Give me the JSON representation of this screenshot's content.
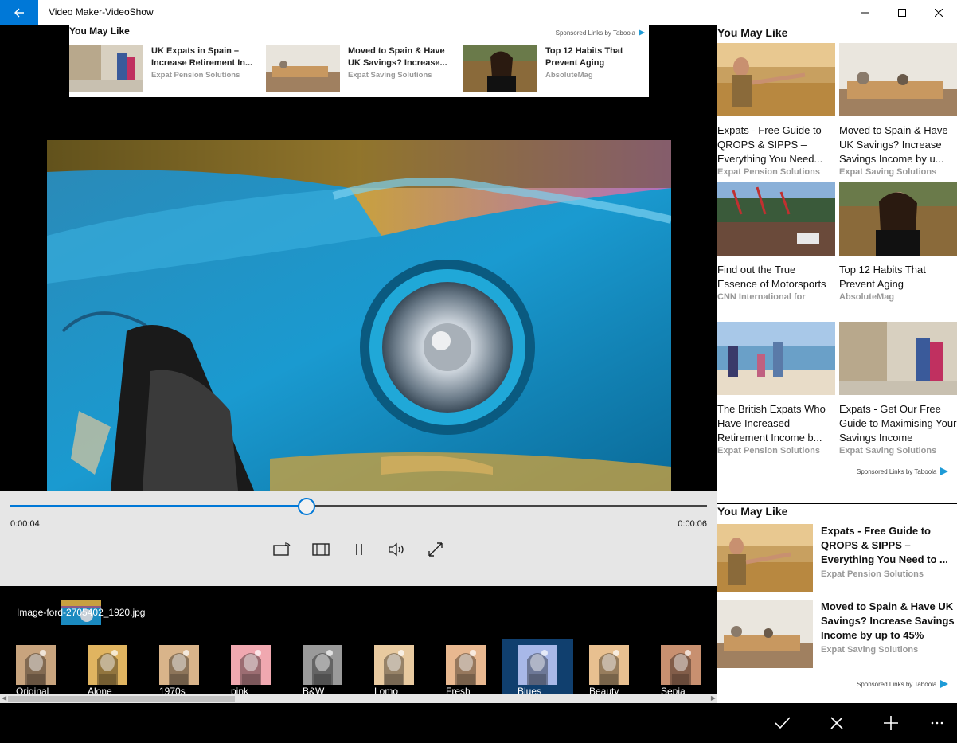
{
  "window": {
    "title": "Video Maker-VideoShow"
  },
  "top_ad": {
    "header": "You May Like",
    "sponsor": "Sponsored Links by Taboola",
    "items": [
      {
        "title": "UK Expats in Spain – Increase Retirement In...",
        "source": "Expat Pension Solutions"
      },
      {
        "title": "Moved to Spain & Have UK Savings? Increase...",
        "source": "Expat Saving Solutions"
      },
      {
        "title": "Top 12 Habits That Prevent Aging",
        "source": "AbsoluteMag"
      }
    ]
  },
  "player": {
    "current_time": "0:00:04",
    "total_time": "0:00:06",
    "progress": 0.425
  },
  "clip": {
    "filename": "Image-ford-2705402_1920.jpg"
  },
  "filters": [
    {
      "label": "Original",
      "tint": "#c8a47e"
    },
    {
      "label": "Alone",
      "tint": "#e0b460"
    },
    {
      "label": "1970s",
      "tint": "#d9b48a"
    },
    {
      "label": "pink",
      "tint": "#f0a8b0"
    },
    {
      "label": "B&W",
      "tint": "#9a9a9a"
    },
    {
      "label": "Lomo",
      "tint": "#e8caa0"
    },
    {
      "label": "Fresh",
      "tint": "#e8b890"
    },
    {
      "label": "Blues",
      "tint": "#a8b8e8"
    },
    {
      "label": "Beauty",
      "tint": "#e8c090"
    },
    {
      "label": "Sepia",
      "tint": "#c89070"
    }
  ],
  "selected_filter": "Blues",
  "side_panel": {
    "header": "You May Like",
    "grid": [
      {
        "title": "Expats - Free Guide to QROPS & SIPPS – Everything You Need...",
        "source": "Expat Pension Solutions"
      },
      {
        "title": "Moved to Spain & Have UK Savings? Increase Savings Income by u...",
        "source": "Expat Saving Solutions"
      },
      {
        "title": "Find out the True Essence of Motorsports",
        "source": "CNN International for"
      },
      {
        "title": "Top 12 Habits That Prevent Aging",
        "source": "AbsoluteMag"
      },
      {
        "title": "The British Expats Who Have Increased Retirement Income b...",
        "source": "Expat Pension Solutions"
      },
      {
        "title": "Expats - Get Our Free Guide to Maximising Your Savings Income",
        "source": "Expat Saving Solutions"
      }
    ],
    "sponsor": "Sponsored Links by Taboola",
    "header2": "You May Like",
    "list": [
      {
        "title": "Expats - Free Guide to QROPS & SIPPS – Everything You Need to ...",
        "source": "Expat Pension Solutions"
      },
      {
        "title": "Moved to Spain & Have UK Savings? Increase Savings Income by up to 45%",
        "source": "Expat Saving Solutions"
      }
    ],
    "sponsor2": "Sponsored Links by Taboola"
  },
  "colors": {
    "accent": "#0078d7",
    "selected_filter_bg": "#103f6e"
  }
}
